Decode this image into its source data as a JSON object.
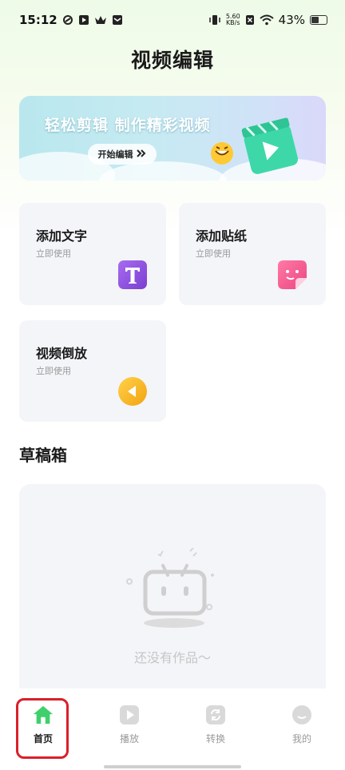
{
  "status_bar": {
    "time": "15:12",
    "net_speed": "5.60",
    "net_unit": "KB/s",
    "battery": "43%",
    "battery_level": 0.43
  },
  "page": {
    "title": "视频编辑"
  },
  "banner": {
    "headline": "轻松剪辑 制作精彩视频",
    "button_label": "开始编辑"
  },
  "features": [
    {
      "title": "添加文字",
      "subtitle": "立即使用",
      "icon": "text-t-icon",
      "color": "#8a4fd8"
    },
    {
      "title": "添加贴纸",
      "subtitle": "立即使用",
      "icon": "sticker-icon",
      "color": "#f0588a"
    },
    {
      "title": "视频倒放",
      "subtitle": "立即使用",
      "icon": "reverse-play-icon",
      "color": "#f5b21e"
    }
  ],
  "drafts": {
    "title": "草稿箱",
    "empty_text": "还没有作品～"
  },
  "bottom_nav": [
    {
      "label": "首页",
      "icon": "home-icon",
      "active": true
    },
    {
      "label": "播放",
      "icon": "play-icon",
      "active": false
    },
    {
      "label": "转换",
      "icon": "convert-icon",
      "active": false
    },
    {
      "label": "我的",
      "icon": "profile-icon",
      "active": false
    }
  ],
  "colors": {
    "accent_green": "#3fd06c",
    "highlight_red": "#d9202a"
  }
}
